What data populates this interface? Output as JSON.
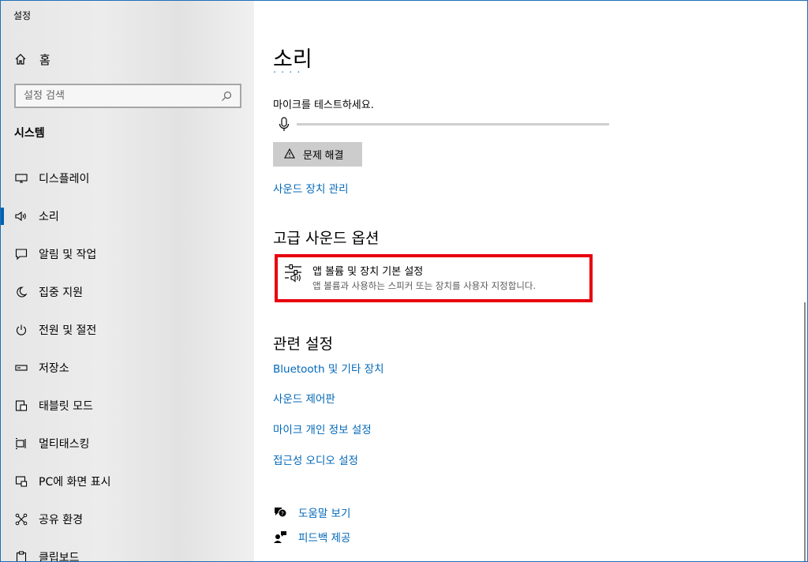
{
  "window": {
    "app_title": "설정",
    "controls": {
      "minimize": "minimize-icon",
      "maximize": "maximize-icon",
      "close": "close-icon"
    }
  },
  "sidebar": {
    "home_label": "홈",
    "search_placeholder": "설정 검색",
    "section_title": "시스템",
    "items": [
      {
        "label": "디스플레이",
        "icon": "display-icon",
        "active": false
      },
      {
        "label": "소리",
        "icon": "speaker-icon",
        "active": true
      },
      {
        "label": "알림 및 작업",
        "icon": "notification-icon",
        "active": false
      },
      {
        "label": "집중 지원",
        "icon": "moon-icon",
        "active": false
      },
      {
        "label": "전원 및 절전",
        "icon": "power-icon",
        "active": false
      },
      {
        "label": "저장소",
        "icon": "storage-icon",
        "active": false
      },
      {
        "label": "태블릿 모드",
        "icon": "tablet-icon",
        "active": false
      },
      {
        "label": "멀티태스킹",
        "icon": "multitasking-icon",
        "active": false
      },
      {
        "label": "PC에 화면 표시",
        "icon": "project-icon",
        "active": false
      },
      {
        "label": "공유 환경",
        "icon": "shared-icon",
        "active": false
      },
      {
        "label": "클립보드",
        "icon": "clipboard-icon",
        "active": false
      }
    ]
  },
  "main": {
    "title": "소리",
    "mic_test_label": "마이크를 테스트하세요.",
    "troubleshoot_label": "문제 해결",
    "manage_devices_link": "사운드 장치 관리",
    "advanced": {
      "heading": "고급 사운드 옵션",
      "item_title": "앱 볼륨 및 장치 기본 설정",
      "item_desc": "앱 볼륨과 사용하는 스피커 또는 장치를 사용자 지정합니다."
    },
    "related": {
      "heading": "관련 설정",
      "links": [
        "Bluetooth 및 기타 장치",
        "사운드 제어판",
        "마이크 개인 정보 설정",
        "접근성 오디오 설정"
      ]
    },
    "help": {
      "get_help": "도움말 보기",
      "feedback": "피드백 제공"
    }
  },
  "colors": {
    "accent": "#0067b8",
    "highlight_box": "#e8000e",
    "button_bg": "#cccccc"
  }
}
